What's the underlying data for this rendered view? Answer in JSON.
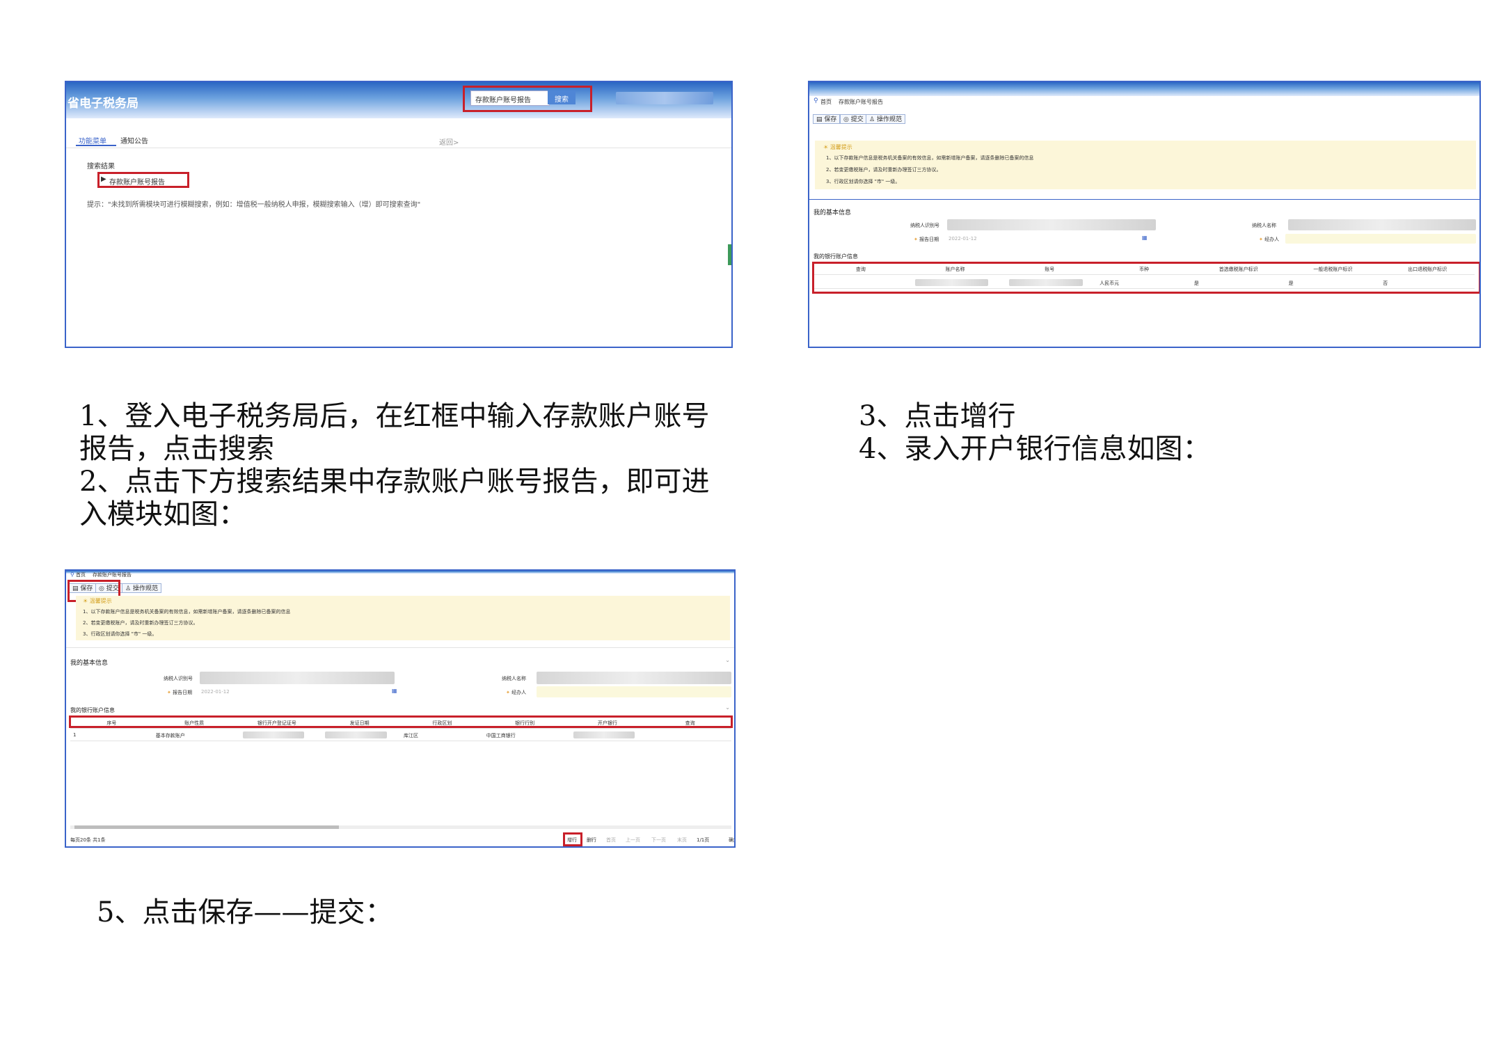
{
  "shot1": {
    "site_title": "省电子税务局",
    "search_value": "存款账户账号报告",
    "search_button": "搜索",
    "tab_menu": "功能菜单",
    "tab_notice": "通知公告",
    "back_link": "返回>",
    "results_heading": "搜索结果",
    "result_item": "存款账户账号报告",
    "tip_text": "提示：\"未找到所需模块可进行模糊搜索，例如：增值税一般纳税人申报，模糊搜索输入（增）即可搜索查询\""
  },
  "shot2": {
    "breadcrumb_home": "首页",
    "breadcrumb_page": "存款账户账号报告",
    "btn_save": "保存",
    "btn_submit": "提交",
    "btn_guide": "操作规范",
    "notice_title": "温馨提示",
    "notice_lines": [
      "1、以下存款账户信息是税务机关备案的有效信息，如需新增账户备案，请逐条删除已备案的信息",
      "2、若变更缴税账户，请及时重新办理签订三方协议。",
      "3、行政区划请你选择 \"市\" 一级。"
    ],
    "basic_info_title": "我的基本信息",
    "label_taxpayer_id": "纳税人识别号",
    "label_taxpayer_name": "纳税人名称",
    "label_report_date": "报告日期",
    "report_date": "2022-01-12",
    "label_handler": "经办人",
    "bank_info_title": "我的银行账户信息",
    "columns": [
      "查询",
      "账户名称",
      "账号",
      "币种",
      "首选缴税账户标识",
      "一般退税账户标识",
      "出口退税账户标识"
    ],
    "row": [
      "",
      "",
      "",
      "人民币元",
      "是",
      "是",
      "否"
    ]
  },
  "shot3": {
    "breadcrumb_home": "首页",
    "breadcrumb_page": "存款账户账号报告",
    "btn_save": "保存",
    "btn_submit": "提交",
    "btn_guide": "操作规范",
    "notice_title": "温馨提示",
    "notice_lines": [
      "1、以下存款账户信息是税务机关备案的有效信息，如需新增账户备案，请逐条删除已备案的信息",
      "2、若变更缴税账户，请及时重新办理签订三方协议。",
      "3、行政区划请你选择 \"市\" 一级。"
    ],
    "basic_info_title": "我的基本信息",
    "label_taxpayer_id": "纳税人识别号",
    "label_taxpayer_name": "纳税人名称",
    "label_report_date": "报告日期",
    "report_date": "2022-01-12",
    "label_handler": "经办人",
    "bank_info_title": "我的银行账户信息",
    "columns": [
      "序号",
      "账户性质",
      "银行开户登记证号",
      "发证日期",
      "行政区划",
      "银行行别",
      "开户银行",
      "查询"
    ],
    "row": [
      "1",
      "基本存款账户",
      "",
      "",
      "库江区",
      "中国工商银行",
      "",
      ""
    ],
    "footer_left": "每页20条 共1条",
    "pager": [
      "增行",
      "删行",
      "首页",
      "上一页",
      "下一页",
      "末页",
      "1/1页",
      "确定"
    ]
  },
  "captions": {
    "step1_line1": "1、登入电子税务局后，在红框中输入存款账户账号",
    "step1_line2": "报告，点击搜索",
    "step2_line1": "2、点击下方搜索结果中存款账户账号报告，即可进",
    "step2_line2": "入模块如图：",
    "step3": "3、点击增行",
    "step4": "4、录入开户银行信息如图：",
    "step5": "5、点击保存——提交："
  },
  "colors": {
    "frame_border": "#3a63c9",
    "highlight_red": "#c8202a",
    "notice_bg": "#fcf6d9"
  }
}
